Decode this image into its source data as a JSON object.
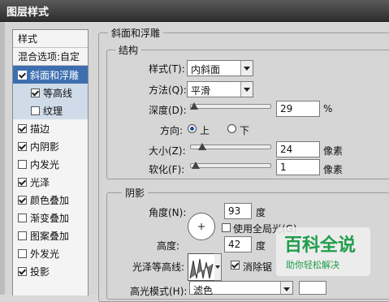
{
  "window": {
    "title": "图层样式"
  },
  "sidebar": {
    "header": "样式",
    "items": [
      {
        "label": "混合选项:自定",
        "checkbox": false,
        "state": "normal"
      },
      {
        "label": "斜面和浮雕",
        "checkbox": true,
        "checked": true,
        "state": "selected"
      },
      {
        "label": "等高线",
        "checkbox": true,
        "checked": true,
        "state": "sub"
      },
      {
        "label": "纹理",
        "checkbox": true,
        "checked": false,
        "state": "sub"
      },
      {
        "label": "描边",
        "checkbox": true,
        "checked": true,
        "state": "normal"
      },
      {
        "label": "内阴影",
        "checkbox": true,
        "checked": true,
        "state": "normal"
      },
      {
        "label": "内发光",
        "checkbox": true,
        "checked": false,
        "state": "normal"
      },
      {
        "label": "光泽",
        "checkbox": true,
        "checked": true,
        "state": "normal"
      },
      {
        "label": "颜色叠加",
        "checkbox": true,
        "checked": true,
        "state": "normal"
      },
      {
        "label": "渐变叠加",
        "checkbox": true,
        "checked": false,
        "state": "normal"
      },
      {
        "label": "图案叠加",
        "checkbox": true,
        "checked": false,
        "state": "normal"
      },
      {
        "label": "外发光",
        "checkbox": true,
        "checked": false,
        "state": "normal"
      },
      {
        "label": "投影",
        "checkbox": true,
        "checked": true,
        "state": "normal"
      }
    ]
  },
  "bevel": {
    "title": "斜面和浮雕",
    "structure": {
      "title": "结构",
      "style_label": "样式(T):",
      "style_value": "内斜面",
      "technique_label": "方法(Q):",
      "technique_value": "平滑",
      "depth_label": "深度(D):",
      "depth_value": "29",
      "depth_unit": "%",
      "direction_label": "方向:",
      "direction_up": "上",
      "direction_down": "下",
      "direction_selected": "上",
      "size_label": "大小(Z):",
      "size_value": "24",
      "size_unit": "像素",
      "soften_label": "软化(F):",
      "soften_value": "1",
      "soften_unit": "像素"
    },
    "shading": {
      "title": "阴影",
      "angle_label": "角度(N):",
      "angle_value": "93",
      "angle_unit": "度",
      "global_light_label": "使用全局光(G)",
      "global_light_checked": false,
      "altitude_label": "高度:",
      "altitude_value": "42",
      "altitude_unit": "度",
      "gloss_contour_label": "光泽等高线:",
      "antialias_label": "消除锯",
      "antialias_checked": true,
      "highlight_mode_label": "高光模式(H):",
      "highlight_mode_value": "滤色"
    }
  },
  "watermark": {
    "main": "百科全说",
    "sub": "助你轻松解决"
  },
  "colors": {
    "selected": "#3d6fb0",
    "sub_item": "#cfdbe9",
    "watermark": "#1e9e4a"
  }
}
